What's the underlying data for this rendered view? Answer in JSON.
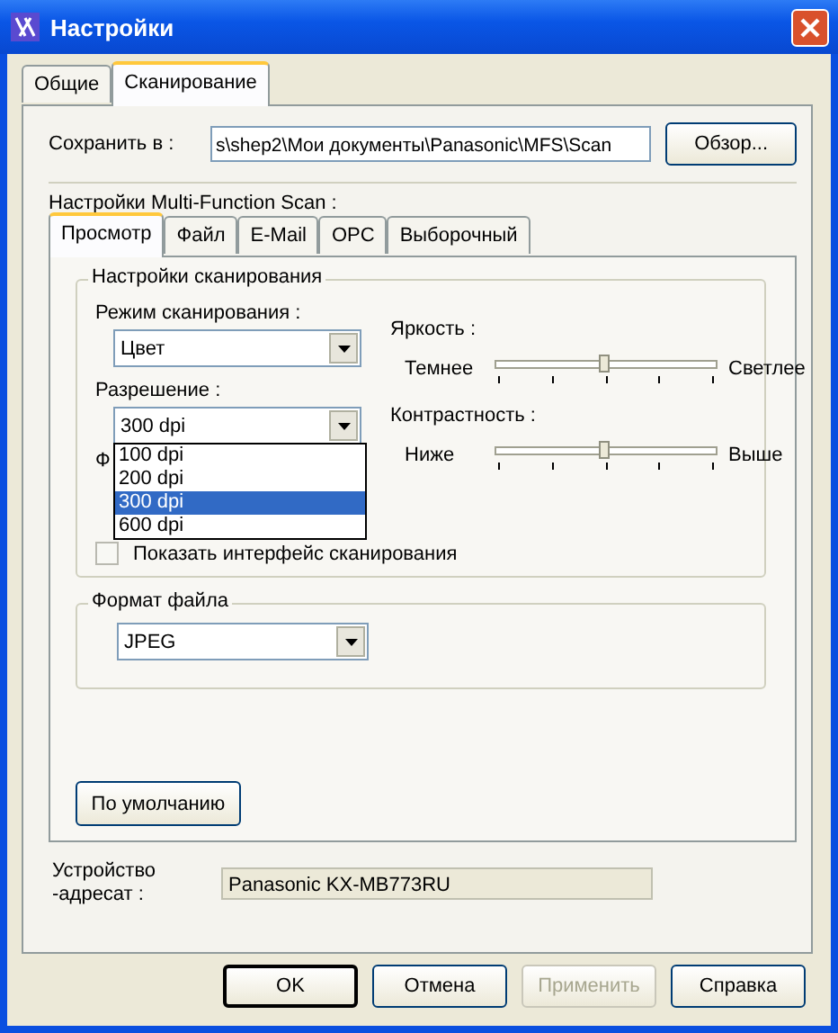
{
  "window": {
    "title": "Настройки"
  },
  "tabs": [
    {
      "label": "Общие",
      "selected": false
    },
    {
      "label": "Сканирование",
      "selected": true
    }
  ],
  "save_to": {
    "label": "Сохранить в :",
    "value": "s\\shep2\\Мои документы\\Panasonic\\MFS\\Scan",
    "browse_button": "Обзор..."
  },
  "section_label": "Настройки Multi-Function Scan :",
  "inner_tabs": [
    {
      "label": "Просмотр",
      "selected": true
    },
    {
      "label": "Файл",
      "selected": false
    },
    {
      "label": "E-Mail",
      "selected": false
    },
    {
      "label": "OPC",
      "selected": false
    },
    {
      "label": "Выборочный",
      "selected": false
    }
  ],
  "scan_settings": {
    "title": "Настройки сканирования",
    "scan_mode": {
      "label": "Режим сканирования :",
      "value": "Цвет"
    },
    "resolution": {
      "label": "Разрешение :",
      "value": "300 dpi",
      "expanded": true,
      "options": [
        {
          "label": "100 dpi",
          "selected": false
        },
        {
          "label": "200 dpi",
          "selected": false
        },
        {
          "label": "300 dpi",
          "selected": true
        },
        {
          "label": "600 dpi",
          "selected": false
        }
      ]
    },
    "covered_label": "Ф",
    "sliders": [
      {
        "label": "Яркость :",
        "min_label": "Темнее",
        "max_label": "Светлее",
        "level": 0.5
      },
      {
        "label": "Контрастность :",
        "min_label": "Ниже",
        "max_label": "Выше",
        "level": 0.5
      }
    ],
    "show_interface": {
      "label": "Показать интерфейс сканирования",
      "checked": false
    }
  },
  "file_format": {
    "title": "Формат файла",
    "value": "JPEG"
  },
  "default_button": "По умолчанию",
  "device": {
    "label": "Устройство -адресат :",
    "value": "Panasonic KX-MB773RU"
  },
  "buttons": [
    {
      "label": "OK",
      "kind": "default",
      "disabled": false
    },
    {
      "label": "Отмена",
      "kind": "normal",
      "disabled": false
    },
    {
      "label": "Применить",
      "kind": "normal",
      "disabled": true
    },
    {
      "label": "Справка",
      "kind": "normal",
      "disabled": false
    }
  ]
}
